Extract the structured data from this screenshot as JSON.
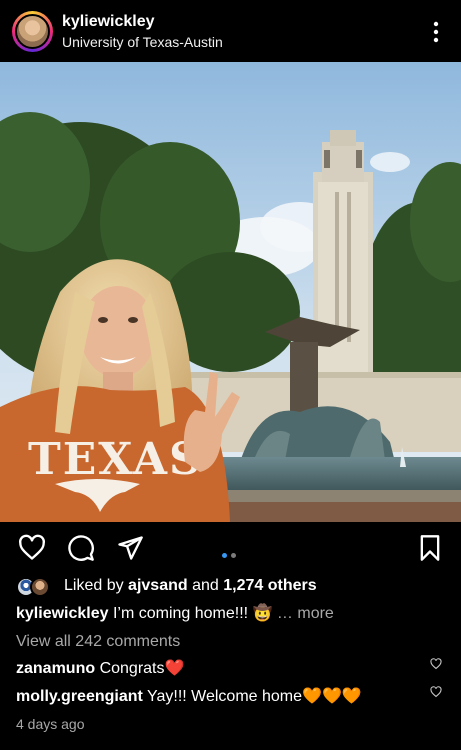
{
  "header": {
    "username": "kyliewickley",
    "location": "University of Texas-Austin",
    "more_icon": "more-vertical-icon"
  },
  "post": {
    "image_subject": "",
    "carousel": {
      "count": 2,
      "active": 1
    },
    "accent_color": "#3897f0"
  },
  "actions": {
    "like_icon": "heart-icon",
    "comment_icon": "comment-icon",
    "share_icon": "send-icon",
    "save_icon": "bookmark-icon"
  },
  "likes": {
    "prefix": "Liked by ",
    "first_user": "ajvsand",
    "middle": " and ",
    "others": "1,274 others"
  },
  "caption": {
    "username": "kyliewickley",
    "text": " I’m coming home!!! 🤠",
    "more": " … more"
  },
  "view_comments": "View all 242 comments",
  "comments": [
    {
      "username": "zanamuno",
      "text": " Congrats❤️"
    },
    {
      "username": "molly.greengiant",
      "text": " Yay!!! Welcome home🧡🧡🧡"
    }
  ],
  "timestamp": "4 days ago"
}
